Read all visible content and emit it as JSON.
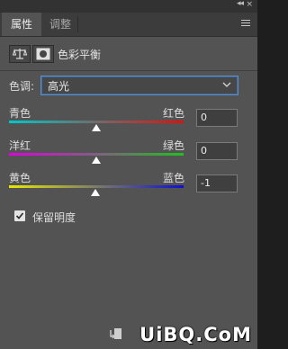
{
  "window": {
    "collapse_glyph": "◂◂",
    "close_glyph": "×"
  },
  "tabs": [
    {
      "label": "属性",
      "active": true
    },
    {
      "label": "调整",
      "active": false
    }
  ],
  "header": {
    "title": "色彩平衡",
    "icons": [
      "color-balance-icon",
      "mask-icon"
    ]
  },
  "tone": {
    "label": "色调:",
    "selected": "高光"
  },
  "sliders": [
    {
      "left_label": "青色",
      "right_label": "红色",
      "value": "0",
      "left_color": "#00c8c8",
      "right_color": "#e01010"
    },
    {
      "left_label": "洋红",
      "right_label": "绿色",
      "value": "0",
      "left_color": "#e000e0",
      "right_color": "#20c020"
    },
    {
      "left_label": "黄色",
      "right_label": "蓝色",
      "value": "-1",
      "left_color": "#e8e800",
      "right_color": "#1010d0"
    }
  ],
  "preserve": {
    "label": "保留明度",
    "checked": true
  },
  "watermark": "UiBQ.CoM"
}
